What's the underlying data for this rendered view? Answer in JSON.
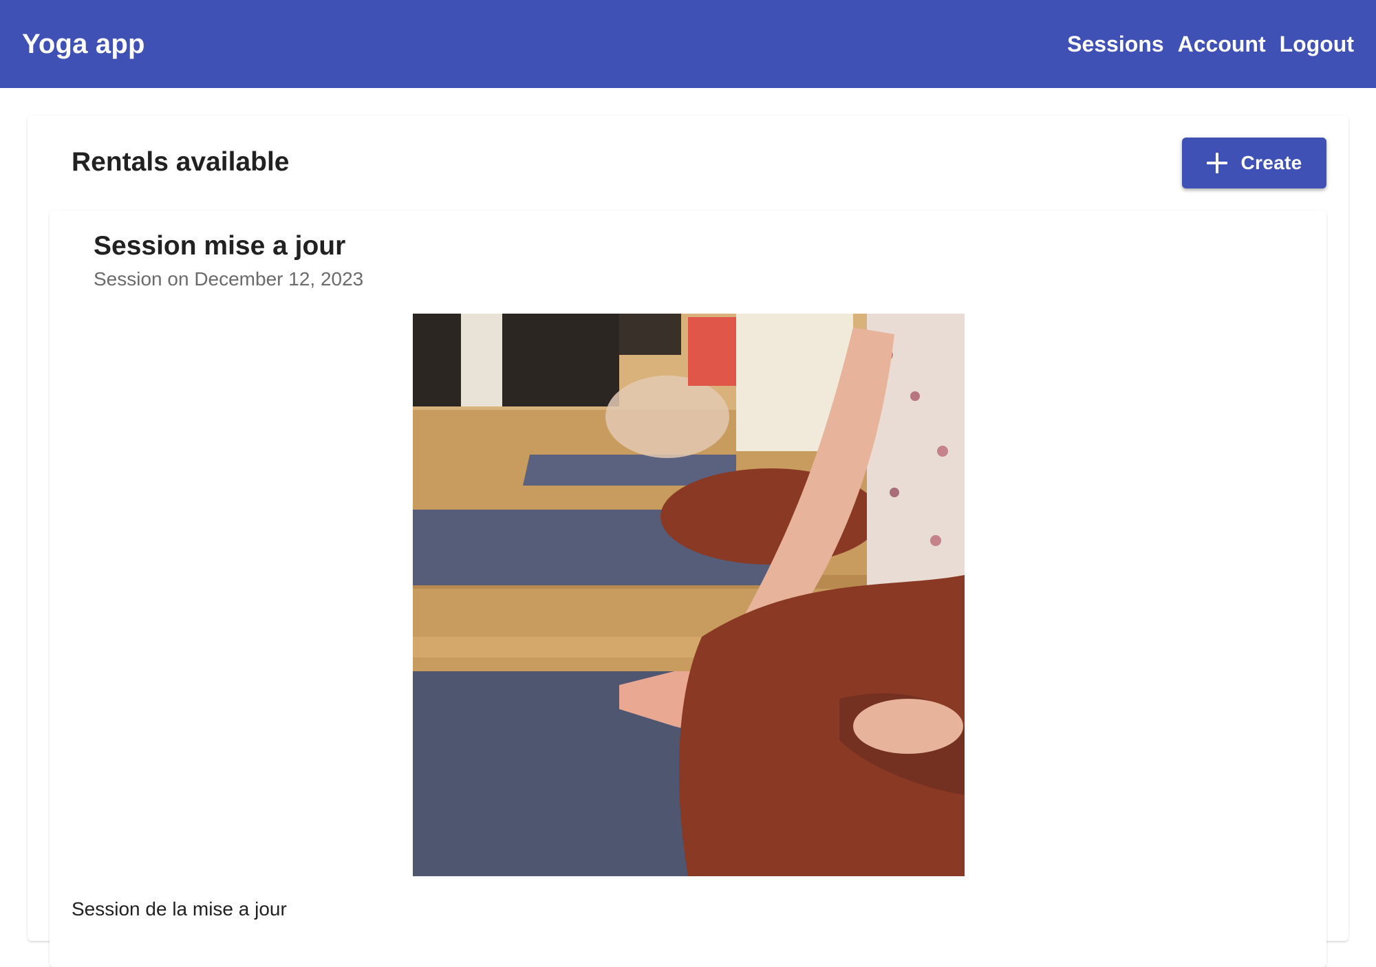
{
  "app": {
    "title": "Yoga app"
  },
  "nav": {
    "sessions": "Sessions",
    "account": "Account",
    "logout": "Logout"
  },
  "rentals": {
    "title": "Rentals available",
    "create_label": "Create"
  },
  "session": {
    "title": "Session mise a jour",
    "subtitle": "Session on December 12, 2023",
    "image_alt": "Yoga class seated in lotus pose",
    "description": "Session de la mise a jour"
  },
  "colors": {
    "primary": "#3f51b5",
    "text": "#212121",
    "subtext": "#6b6b6b"
  }
}
